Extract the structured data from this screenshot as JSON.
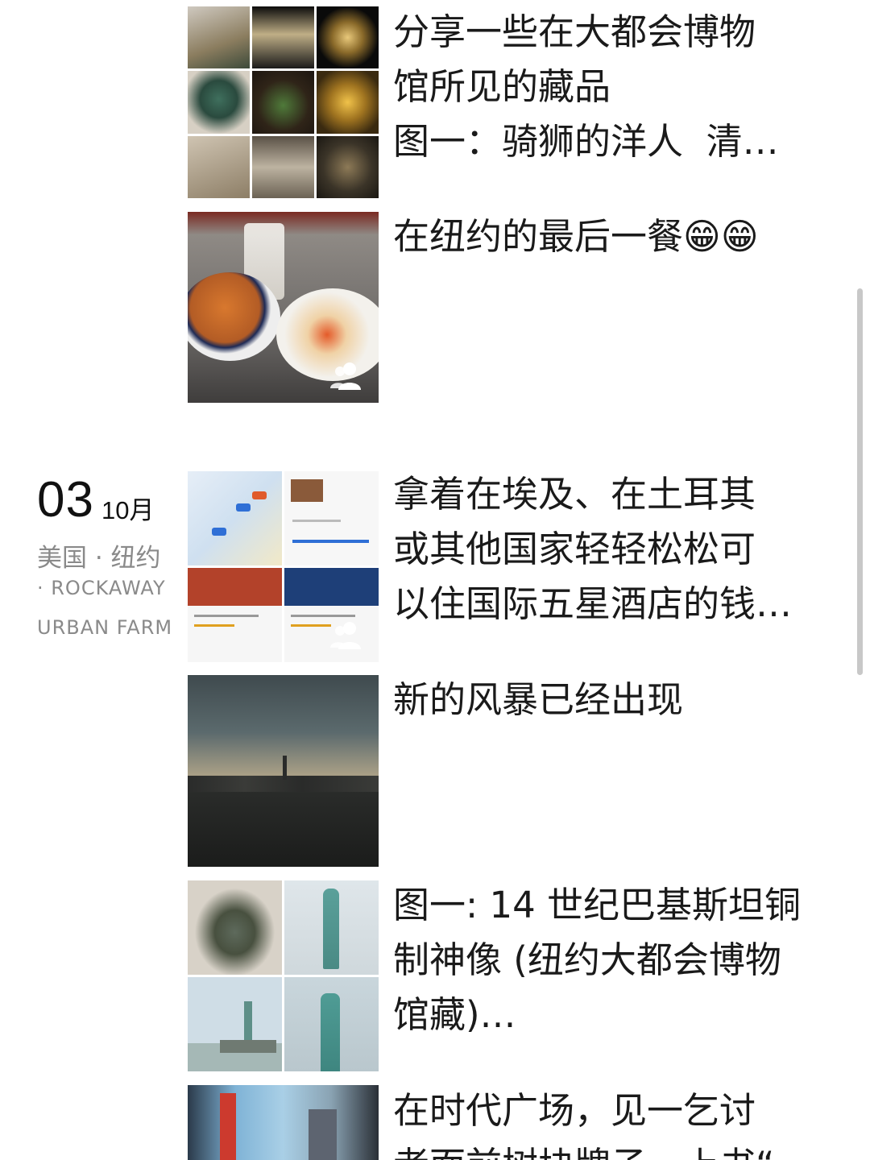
{
  "date": {
    "day": "03",
    "month": "10月"
  },
  "location": {
    "line1": "美国 · 纽约",
    "line2": "· ROCKAWAY",
    "line3": "URBAN FARM"
  },
  "posts": [
    {
      "text": "分享一些在大都会博物\n馆所见的藏品\n图一：骑狮的洋人  清…",
      "image": "museum-collection-grid"
    },
    {
      "text": "在纽约的最后一餐😁😁",
      "image": "last-meal-photo"
    },
    {
      "text": "拿着在埃及、在土耳其\n或其他国家轻轻松松可\n以住国际五星酒店的钱…",
      "image": "hotel-app-screenshots"
    },
    {
      "text": "新的风暴已经出现",
      "image": "storm-skyline-photo"
    },
    {
      "text": "图一: 14 世纪巴基斯坦铜\n制神像 (纽约大都会博物\n馆藏)…",
      "image": "statue-liberty-grid"
    },
    {
      "text": "在时代广场，见一乞讨\n者面前树块牌子，上书“",
      "image": "times-square-photo"
    }
  ],
  "icons": {
    "person": "person-icon",
    "scrollbar": "scrollbar"
  }
}
